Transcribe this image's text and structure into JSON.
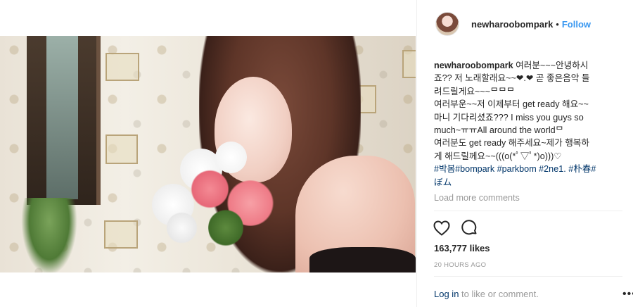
{
  "post": {
    "image_alt": "",
    "header": {
      "username": "newharoobompark",
      "separator": "•",
      "follow_label": "Follow"
    },
    "caption": {
      "username": "newharoobompark",
      "lines": [
        "여러분~~~안녕하시",
        "죠?? 저 노래할래요~~❤.❤ 곧 좋은음악 들",
        "려드릴게요~~~ᄆᄆᄆ",
        "여러부운~~저 이제부터 get ready 해요~~",
        "마니 기다리셨죠??? I miss you guys so",
        "much~ㅠㅠAll around the worldᄆ",
        "여러분도 get ready 해주세요~제가 행복하",
        "게 해드릴께요~~(((o(*ﾟ▽ﾟ*)o)))♡"
      ],
      "hashtags_line1": "#박봄#bompark #parkbom #2ne1. #朴春#",
      "hashtags_line2": "ぼム"
    },
    "load_more_label": "Load more comments",
    "likes_label": "163,777 likes",
    "time_label": "20 HOURS AGO",
    "login_link": "Log in",
    "login_rest": " to like or comment.",
    "more_label": "•••",
    "icons": {
      "like": "heart-icon",
      "comment": "comment-icon"
    }
  }
}
